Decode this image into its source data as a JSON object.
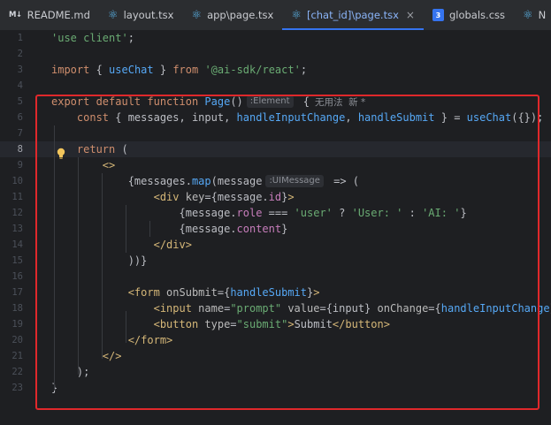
{
  "tabs": [
    {
      "name": "tab-readme",
      "label": "README.md",
      "icon": "markdown-icon",
      "active": false
    },
    {
      "name": "tab-layout",
      "label": "layout.tsx",
      "icon": "react-icon",
      "active": false
    },
    {
      "name": "tab-app-page",
      "label": "app\\page.tsx",
      "icon": "react-icon",
      "active": false
    },
    {
      "name": "tab-chat-page",
      "label": "[chat_id]\\page.tsx",
      "icon": "react-icon",
      "active": true
    },
    {
      "name": "tab-globals",
      "label": "globals.css",
      "icon": "css-icon",
      "active": false
    },
    {
      "name": "tab-next",
      "label": "N",
      "icon": "react-icon",
      "active": false
    }
  ],
  "icon_glyphs": {
    "markdown": "M↓",
    "react": "⚛",
    "css": "3",
    "close": "×"
  },
  "active_line": 8,
  "lines": [
    {
      "n": "1",
      "tokens": [
        {
          "t": "'use client'",
          "c": "str"
        },
        {
          "t": ";",
          "c": ""
        }
      ]
    },
    {
      "n": "2",
      "tokens": []
    },
    {
      "n": "3",
      "tokens": [
        {
          "t": "import",
          "c": "kw"
        },
        {
          "t": " { ",
          "c": ""
        },
        {
          "t": "useChat",
          "c": "var"
        },
        {
          "t": " } ",
          "c": ""
        },
        {
          "t": "from",
          "c": "kw"
        },
        {
          "t": " ",
          "c": ""
        },
        {
          "t": "'@ai-sdk/react'",
          "c": "str"
        },
        {
          "t": ";",
          "c": ""
        }
      ]
    },
    {
      "n": "4",
      "tokens": []
    },
    {
      "n": "5",
      "tokens": [
        {
          "t": "export default function",
          "c": "kw"
        },
        {
          "t": " ",
          "c": ""
        },
        {
          "t": "Page",
          "c": "fn"
        },
        {
          "t": "()",
          "c": ""
        },
        {
          "t": ":Element",
          "c": "hint"
        },
        {
          "t": " {",
          "c": ""
        },
        {
          "t": "无用法  新 *",
          "c": "inlay"
        }
      ]
    },
    {
      "n": "6",
      "tokens": [
        {
          "t": "    ",
          "c": ""
        },
        {
          "t": "const",
          "c": "kw"
        },
        {
          "t": " { messages, input, ",
          "c": ""
        },
        {
          "t": "handleInputChange",
          "c": "var"
        },
        {
          "t": ", ",
          "c": ""
        },
        {
          "t": "handleSubmit",
          "c": "var"
        },
        {
          "t": " } = ",
          "c": ""
        },
        {
          "t": "useChat",
          "c": "fn"
        },
        {
          "t": "({});",
          "c": ""
        }
      ]
    },
    {
      "n": "7",
      "tokens": []
    },
    {
      "n": "8",
      "tokens": [
        {
          "t": "    ",
          "c": ""
        },
        {
          "t": "return",
          "c": "kw"
        },
        {
          "t": " (",
          "c": ""
        }
      ]
    },
    {
      "n": "9",
      "tokens": [
        {
          "t": "        ",
          "c": ""
        },
        {
          "t": "<>",
          "c": "tag"
        }
      ]
    },
    {
      "n": "10",
      "tokens": [
        {
          "t": "            {messages.",
          "c": ""
        },
        {
          "t": "map",
          "c": "fn"
        },
        {
          "t": "(message",
          "c": ""
        },
        {
          "t": ":UIMessage",
          "c": "hint"
        },
        {
          "t": " => (",
          "c": ""
        }
      ]
    },
    {
      "n": "11",
      "tokens": [
        {
          "t": "                ",
          "c": ""
        },
        {
          "t": "<div",
          "c": "tag"
        },
        {
          "t": " key",
          "c": "attr"
        },
        {
          "t": "={message.",
          "c": ""
        },
        {
          "t": "id",
          "c": "prop"
        },
        {
          "t": "}",
          "c": ""
        },
        {
          "t": ">",
          "c": "tag"
        }
      ]
    },
    {
      "n": "12",
      "tokens": [
        {
          "t": "                    {message.",
          "c": ""
        },
        {
          "t": "role",
          "c": "prop"
        },
        {
          "t": " === ",
          "c": ""
        },
        {
          "t": "'user'",
          "c": "str"
        },
        {
          "t": " ? ",
          "c": ""
        },
        {
          "t": "'User: '",
          "c": "str"
        },
        {
          "t": " : ",
          "c": ""
        },
        {
          "t": "'AI: '",
          "c": "str"
        },
        {
          "t": "}",
          "c": ""
        }
      ]
    },
    {
      "n": "13",
      "tokens": [
        {
          "t": "                    {message.",
          "c": ""
        },
        {
          "t": "content",
          "c": "prop"
        },
        {
          "t": "}",
          "c": ""
        }
      ]
    },
    {
      "n": "14",
      "tokens": [
        {
          "t": "                ",
          "c": ""
        },
        {
          "t": "</div>",
          "c": "tag"
        }
      ]
    },
    {
      "n": "15",
      "tokens": [
        {
          "t": "            ))}",
          "c": ""
        }
      ]
    },
    {
      "n": "16",
      "tokens": []
    },
    {
      "n": "17",
      "tokens": [
        {
          "t": "            ",
          "c": ""
        },
        {
          "t": "<form",
          "c": "tag"
        },
        {
          "t": " onSubmit",
          "c": "attr"
        },
        {
          "t": "={",
          "c": ""
        },
        {
          "t": "handleSubmit",
          "c": "var"
        },
        {
          "t": "}",
          "c": ""
        },
        {
          "t": ">",
          "c": "tag"
        }
      ]
    },
    {
      "n": "18",
      "tokens": [
        {
          "t": "                ",
          "c": ""
        },
        {
          "t": "<input",
          "c": "tag"
        },
        {
          "t": " name",
          "c": "attr"
        },
        {
          "t": "=",
          "c": ""
        },
        {
          "t": "\"prompt\"",
          "c": "str"
        },
        {
          "t": " value",
          "c": "attr"
        },
        {
          "t": "={input} ",
          "c": ""
        },
        {
          "t": "onChange",
          "c": "attr"
        },
        {
          "t": "={",
          "c": ""
        },
        {
          "t": "handleInputChange",
          "c": "var"
        },
        {
          "t": "} ",
          "c": ""
        },
        {
          "t": "/>",
          "c": "tag"
        }
      ]
    },
    {
      "n": "19",
      "tokens": [
        {
          "t": "                ",
          "c": ""
        },
        {
          "t": "<button",
          "c": "tag"
        },
        {
          "t": " type",
          "c": "attr"
        },
        {
          "t": "=",
          "c": ""
        },
        {
          "t": "\"submit\"",
          "c": "str"
        },
        {
          "t": ">",
          "c": "tag"
        },
        {
          "t": "Submit",
          "c": ""
        },
        {
          "t": "</button>",
          "c": "tag"
        }
      ]
    },
    {
      "n": "20",
      "tokens": [
        {
          "t": "            ",
          "c": ""
        },
        {
          "t": "</form>",
          "c": "tag"
        }
      ]
    },
    {
      "n": "21",
      "tokens": [
        {
          "t": "        ",
          "c": ""
        },
        {
          "t": "</>",
          "c": "tag"
        }
      ]
    },
    {
      "n": "22",
      "tokens": [
        {
          "t": "    );",
          "c": ""
        }
      ]
    },
    {
      "n": "23",
      "tokens": [
        {
          "t": "}",
          "c": ""
        }
      ]
    }
  ],
  "colors": {
    "highlight_box": "#e0282b",
    "active_tab_underline": "#3574f0",
    "bulb": "#f2c55c"
  }
}
